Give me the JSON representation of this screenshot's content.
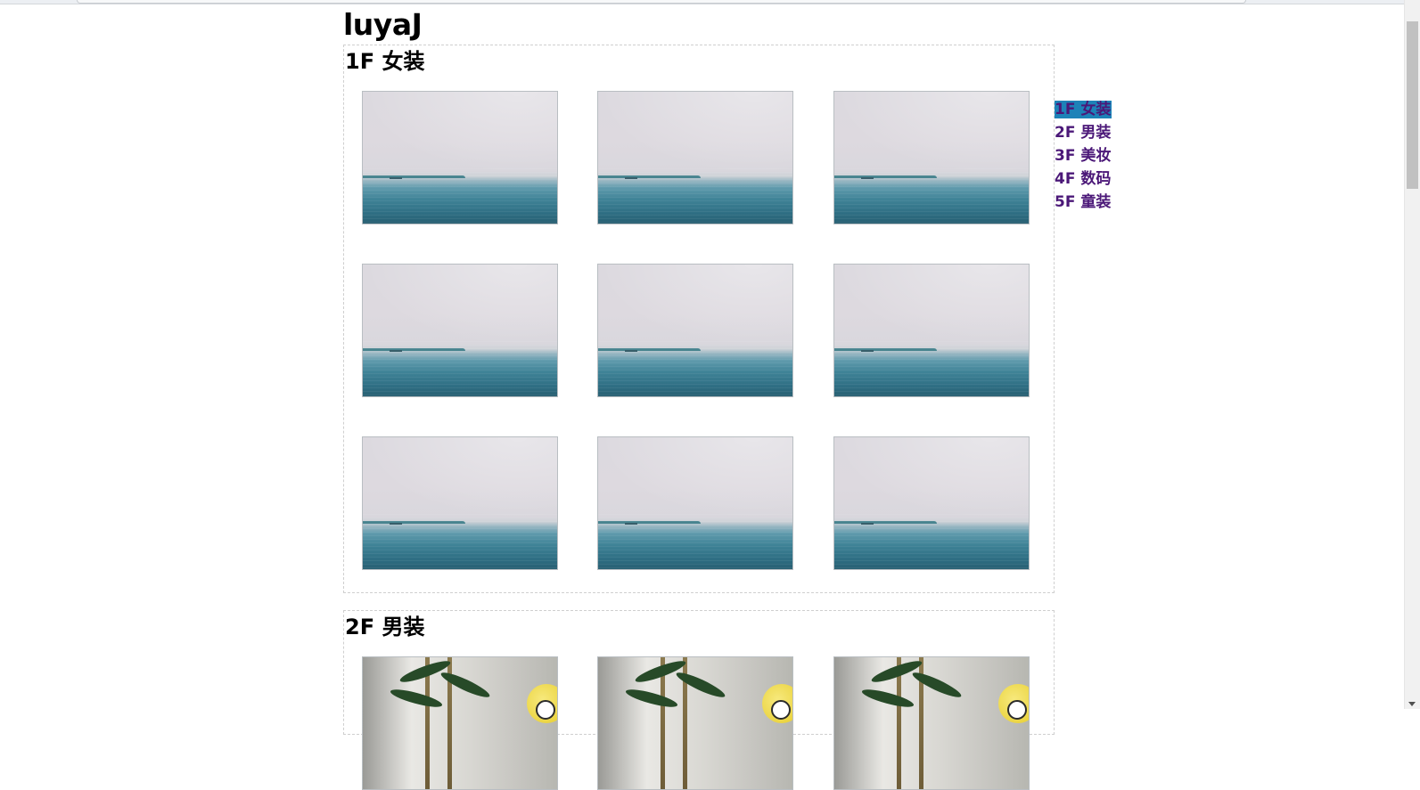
{
  "site": {
    "title": "luyaJ"
  },
  "floors": [
    {
      "title": "1F 女装",
      "image_kind": "sea-photo",
      "image_count": 9
    },
    {
      "title": "2F 男装",
      "image_kind": "plant-photo",
      "image_count": 3
    }
  ],
  "side_nav": {
    "active_index": 0,
    "active_color": "#1d82b8",
    "link_color": "#4b1878",
    "items": [
      {
        "label": "1F 女装"
      },
      {
        "label": "2F 男装"
      },
      {
        "label": "3F 美妆"
      },
      {
        "label": "4F 数码"
      },
      {
        "label": "5F 童装"
      }
    ]
  }
}
